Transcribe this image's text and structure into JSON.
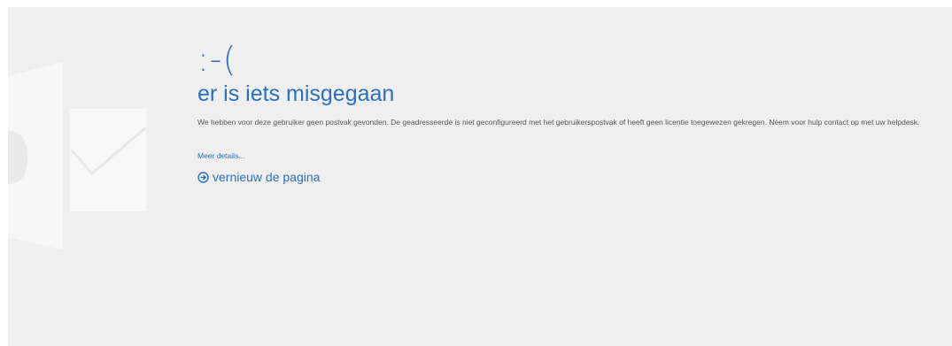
{
  "error": {
    "face": ":-(",
    "title": "er is iets misgegaan",
    "message": "We hebben voor deze gebruiker geen postvak gevonden. De geadresseerde is niet geconfigureerd met het gebruikerspostvak of heeft geen licentie toegewezen gekregen. Neem voor hulp contact op met uw helpdesk.",
    "details_link": "Meer details...",
    "refresh_label": "vernieuw de pagina"
  },
  "icons": {
    "watermark": "outlook-logo-icon",
    "refresh": "arrow-circle-right-icon"
  },
  "colors": {
    "accent": "#2a6fc0",
    "background": "#efefef",
    "text": "#555555"
  }
}
